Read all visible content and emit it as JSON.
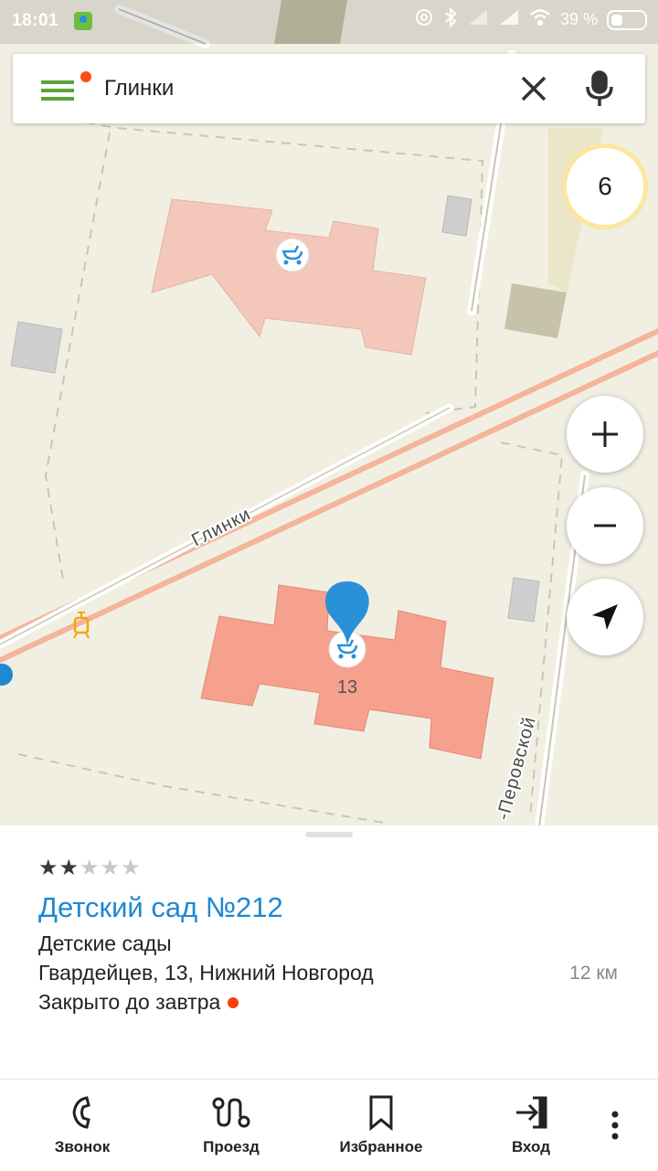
{
  "status_bar": {
    "time": "18:01",
    "battery": "39 %"
  },
  "search": {
    "query": "Глинки"
  },
  "map": {
    "zoom_level": "6",
    "street_primary": "Глинки",
    "street_secondary": "-Перовской",
    "building_number": "13",
    "colors": {
      "background": "#f1efe2",
      "road": "#f5b49b",
      "selected_building": "#f6a08e",
      "building": "#f4c7bb",
      "pin": "#2a90d8"
    }
  },
  "card": {
    "rating": {
      "filled": 2,
      "total": 5
    },
    "title": "Детский сад №212",
    "category": "Детские сады",
    "address": "Гвардейцев, 13, Нижний Новгород",
    "distance": "12 км",
    "status": "Закрыто до завтра"
  },
  "actions": [
    {
      "label": "Звонок",
      "icon": "phone-icon"
    },
    {
      "label": "Проезд",
      "icon": "route-icon"
    },
    {
      "label": "Избранное",
      "icon": "bookmark-icon"
    },
    {
      "label": "Вход",
      "icon": "login-icon"
    }
  ]
}
